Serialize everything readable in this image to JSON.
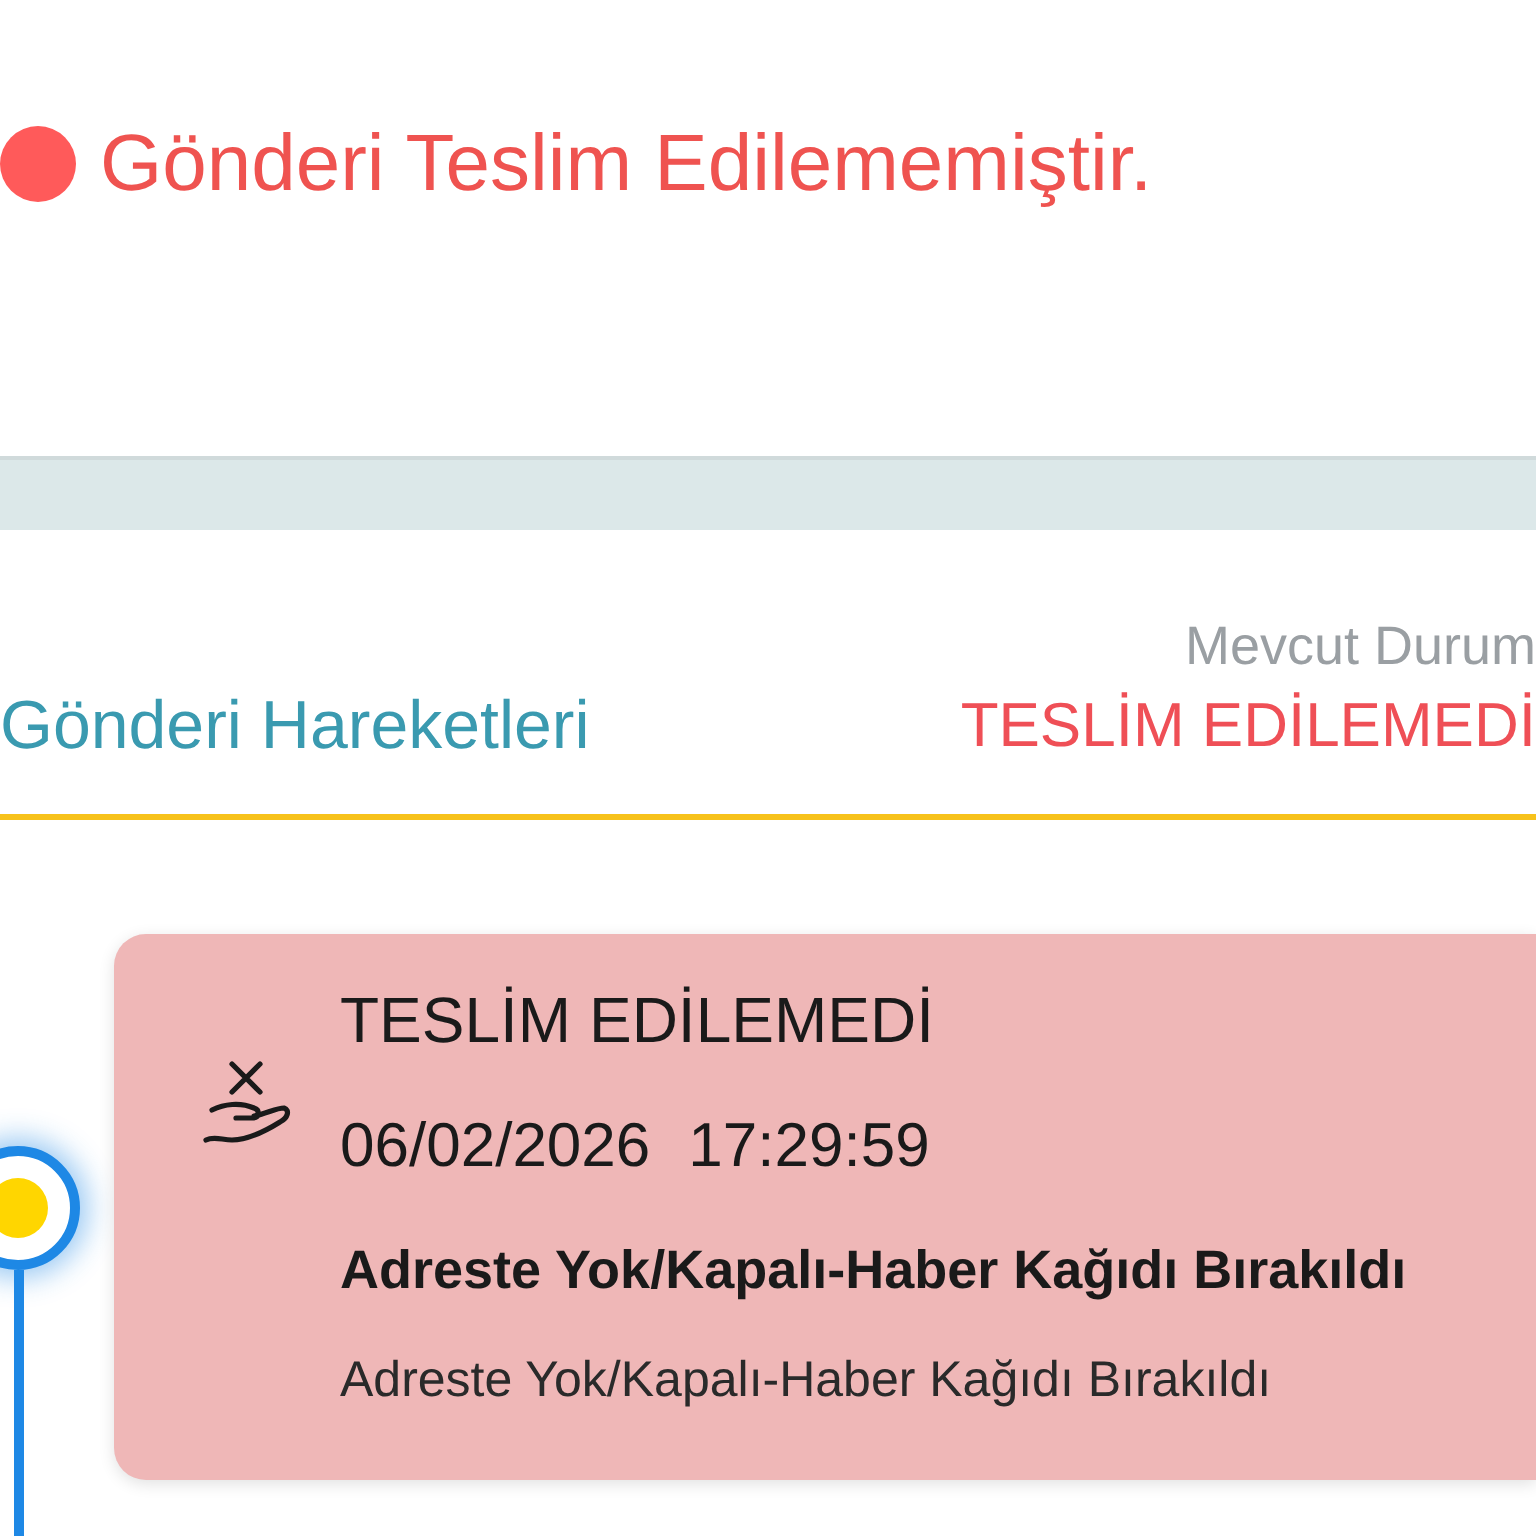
{
  "header": {
    "kind": "failed",
    "status_message": "Gönderi Teslim Edilememiştir."
  },
  "tracking": {
    "title": "Gönderi Hareketleri",
    "current_status_label": "Mevcut Durum",
    "current_status": "TESLİM EDİLEMEDİ"
  },
  "events": [
    {
      "kind": "failed",
      "current": true,
      "status": "TESLİM EDİLEMEDİ",
      "date": "06/02/2026",
      "time": "17:29:59",
      "description": "Adreste Yok/Kapalı-Haber Kağıdı Bırakıldı",
      "detail": "Adreste Yok/Kapalı-Haber Kağıdı Bırakıldı"
    }
  ]
}
